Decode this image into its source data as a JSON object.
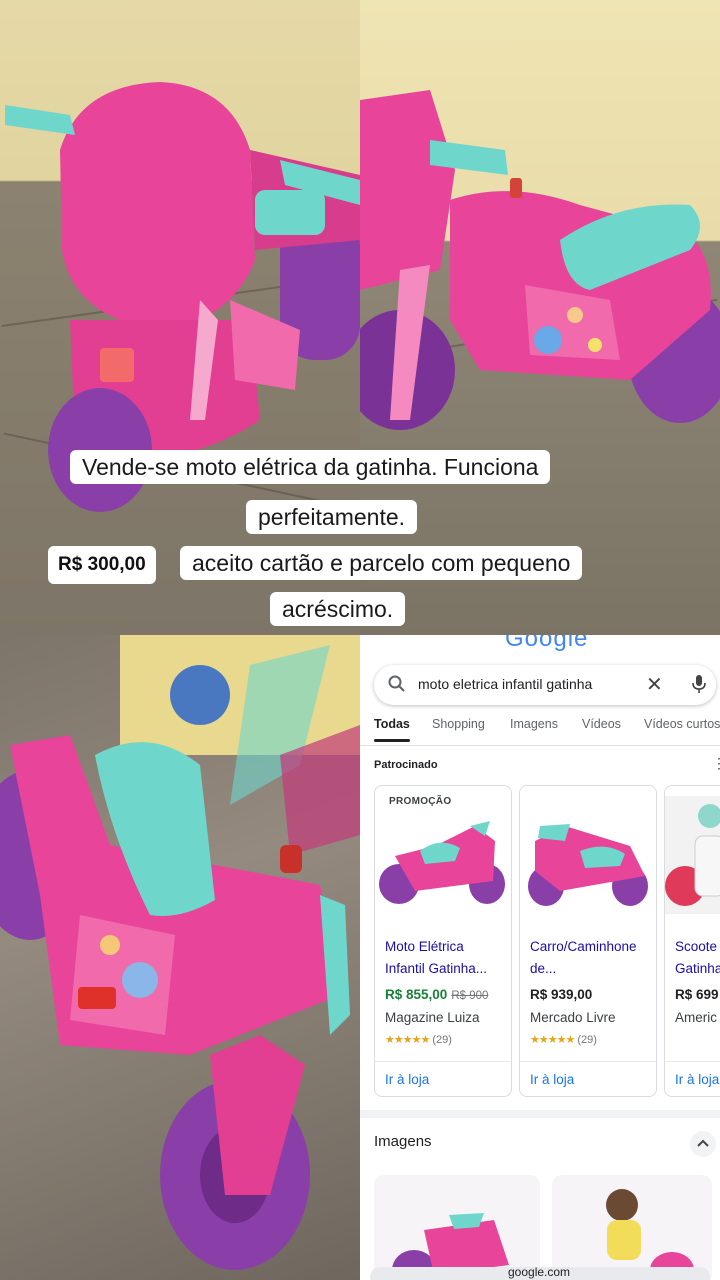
{
  "caption": {
    "line1": "Vende-se moto elétrica da gatinha. Funciona",
    "line2": "perfeitamente.",
    "price_tag": "R$ 300,00",
    "line3": "aceito cartão e parcelo com pequeno",
    "line4": "acréscimo."
  },
  "google": {
    "logo": "Google",
    "search": {
      "query": "moto eletrica infantil gatinha"
    },
    "tabs": [
      {
        "label": "Todas"
      },
      {
        "label": "Shopping"
      },
      {
        "label": "Imagens"
      },
      {
        "label": "Vídeos"
      },
      {
        "label": "Vídeos curtos"
      }
    ],
    "sponsored_label": "Patrocinado",
    "products": [
      {
        "badge": "PROMOÇÃO",
        "title_line1": "Moto Elétrica",
        "title_line2": "Infantil Gatinha...",
        "price": "R$ 855,00",
        "old_price": "R$ 900",
        "store": "Magazine Luiza",
        "stars": "★★★★★",
        "reviews": "(29)",
        "action": "Ir à loja"
      },
      {
        "badge": "",
        "title_line1": "Carro/Caminhone",
        "title_line2": "de...",
        "price": "R$ 939,00",
        "old_price": "",
        "store": "Mercado Livre",
        "stars": "★★★★★",
        "reviews": "(29)",
        "action": "Ir à loja"
      },
      {
        "badge": "",
        "title_line1": "Scoote",
        "title_line2": "Gatinha",
        "price": "R$ 699",
        "old_price": "",
        "store": "Americ",
        "stars": "",
        "reviews": "",
        "action": "Ir à loja"
      }
    ],
    "images_section_title": "Imagens",
    "url": "google.com"
  },
  "colors": {
    "toy_pink": "#e8449a",
    "toy_teal": "#6fd6cc",
    "toy_purple": "#8a3fa8",
    "link_blue": "#1a0dab",
    "sale_green": "#188038"
  }
}
